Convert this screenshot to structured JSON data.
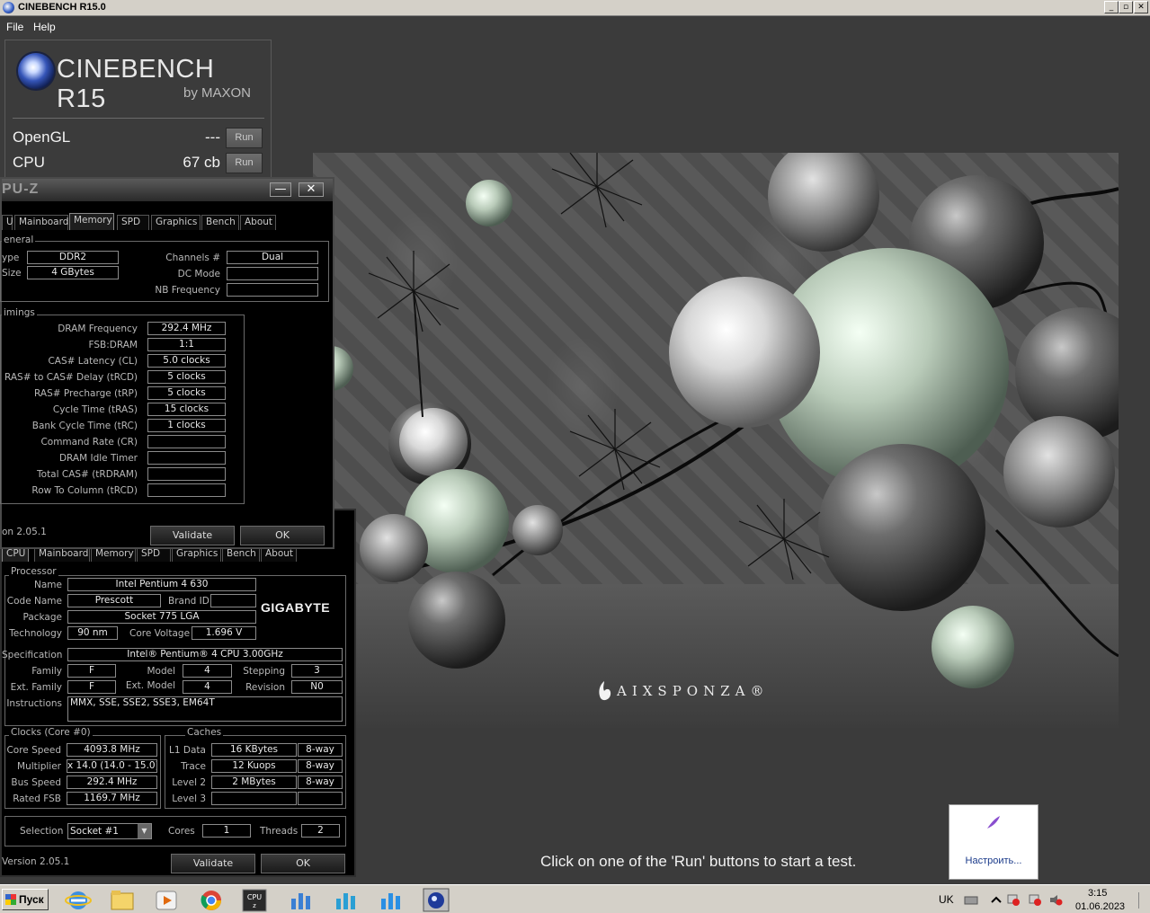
{
  "window": {
    "title": "CINEBENCH R15.0",
    "minimize_glyph": "_",
    "restore_glyph": "▫",
    "close_glyph": "✕"
  },
  "menu": {
    "file": "File",
    "help": "Help"
  },
  "cinebench": {
    "logo_title": "CINEBENCH R15",
    "logo_sub": "by MAXON",
    "opengl_label": "OpenGL",
    "opengl_value": "---",
    "cpu_label": "CPU",
    "cpu_value": "67 cb",
    "run_label": "Run"
  },
  "render": {
    "brand": "AIXSPONZA®"
  },
  "status_message": "Click on one of the 'Run' buttons to start a test.",
  "cpuz_memory": {
    "title": "PU-Z",
    "minimize_glyph": "—",
    "close_glyph": "✕",
    "tabs": [
      "U",
      "Mainboard",
      "Memory",
      "SPD",
      "Graphics",
      "Bench",
      "About"
    ],
    "active_tab": "Memory",
    "general_title": "eneral",
    "type_label": "ype",
    "type_value": "DDR2",
    "size_label": "Size",
    "size_value": "4 GBytes",
    "channels_label": "Channels #",
    "channels_value": "Dual",
    "dc_mode_label": "DC Mode",
    "dc_mode_value": "",
    "nb_freq_label": "NB Frequency",
    "nb_freq_value": "",
    "timings_title": "imings",
    "timings": [
      {
        "label": "DRAM Frequency",
        "value": "292.4 MHz"
      },
      {
        "label": "FSB:DRAM",
        "value": "1:1"
      },
      {
        "label": "CAS# Latency (CL)",
        "value": "5.0 clocks"
      },
      {
        "label": "RAS# to CAS# Delay (tRCD)",
        "value": "5 clocks"
      },
      {
        "label": "RAS# Precharge (tRP)",
        "value": "5 clocks"
      },
      {
        "label": "Cycle Time (tRAS)",
        "value": "15 clocks"
      },
      {
        "label": "Bank Cycle Time (tRC)",
        "value": "1 clocks"
      },
      {
        "label": "Command Rate (CR)",
        "value": ""
      },
      {
        "label": "DRAM Idle Timer",
        "value": ""
      },
      {
        "label": "Total CAS# (tRDRAM)",
        "value": ""
      },
      {
        "label": "Row To Column (tRCD)",
        "value": ""
      }
    ],
    "version": "on 2.05.1",
    "validate": "Validate",
    "ok": "OK"
  },
  "cpuz_cpu": {
    "tabs": [
      "CPU",
      "Mainboard",
      "Memory",
      "SPD",
      "Graphics",
      "Bench",
      "About"
    ],
    "processor_title": "Processor",
    "name_label": "Name",
    "name_value": "Intel Pentium 4 630",
    "codename_label": "Code Name",
    "codename_value": "Prescott",
    "brandid_label": "Brand ID",
    "brandid_value": "",
    "package_label": "Package",
    "package_value": "Socket 775 LGA",
    "technology_label": "Technology",
    "technology_value": "90 nm",
    "corevoltage_label": "Core Voltage",
    "corevoltage_value": "1.696 V",
    "brand_logo": "GIGABYTE",
    "spec_label": "Specification",
    "spec_value": "Intel® Pentium® 4 CPU 3.00GHz",
    "family_label": "Family",
    "family_value": "F",
    "model_label": "Model",
    "model_value": "4",
    "stepping_label": "Stepping",
    "stepping_value": "3",
    "extfamily_label": "Ext. Family",
    "extfamily_value": "F",
    "extmodel_label": "Ext. Model",
    "extmodel_value": "4",
    "revision_label": "Revision",
    "revision_value": "N0",
    "instructions_label": "Instructions",
    "instructions_value": "MMX, SSE, SSE2, SSE3, EM64T",
    "clocks_title": "Clocks (Core #0)",
    "corespeed_label": "Core Speed",
    "corespeed_value": "4093.8 MHz",
    "multiplier_label": "Multiplier",
    "multiplier_value": "x 14.0 (14.0 - 15.0)",
    "busspeed_label": "Bus Speed",
    "busspeed_value": "292.4 MHz",
    "ratedfsb_label": "Rated FSB",
    "ratedfsb_value": "1169.7 MHz",
    "caches_title": "Caches",
    "caches": [
      {
        "label": "L1 Data",
        "size": "16 KBytes",
        "ways": "8-way"
      },
      {
        "label": "Trace",
        "size": "12 Kuops",
        "ways": "8-way"
      },
      {
        "label": "Level 2",
        "size": "2 MBytes",
        "ways": "8-way"
      },
      {
        "label": "Level 3",
        "size": "",
        "ways": ""
      }
    ],
    "selection_label": "Selection",
    "selection_value": "Socket #1",
    "cores_label": "Cores",
    "cores_value": "1",
    "threads_label": "Threads",
    "threads_value": "2",
    "version": "Version 2.05.1",
    "validate": "Validate",
    "ok": "OK"
  },
  "notification": {
    "label": "Настроить..."
  },
  "taskbar": {
    "start": "Пуск",
    "lang": "UK",
    "time": "3:15",
    "date": "01.06.2023"
  }
}
